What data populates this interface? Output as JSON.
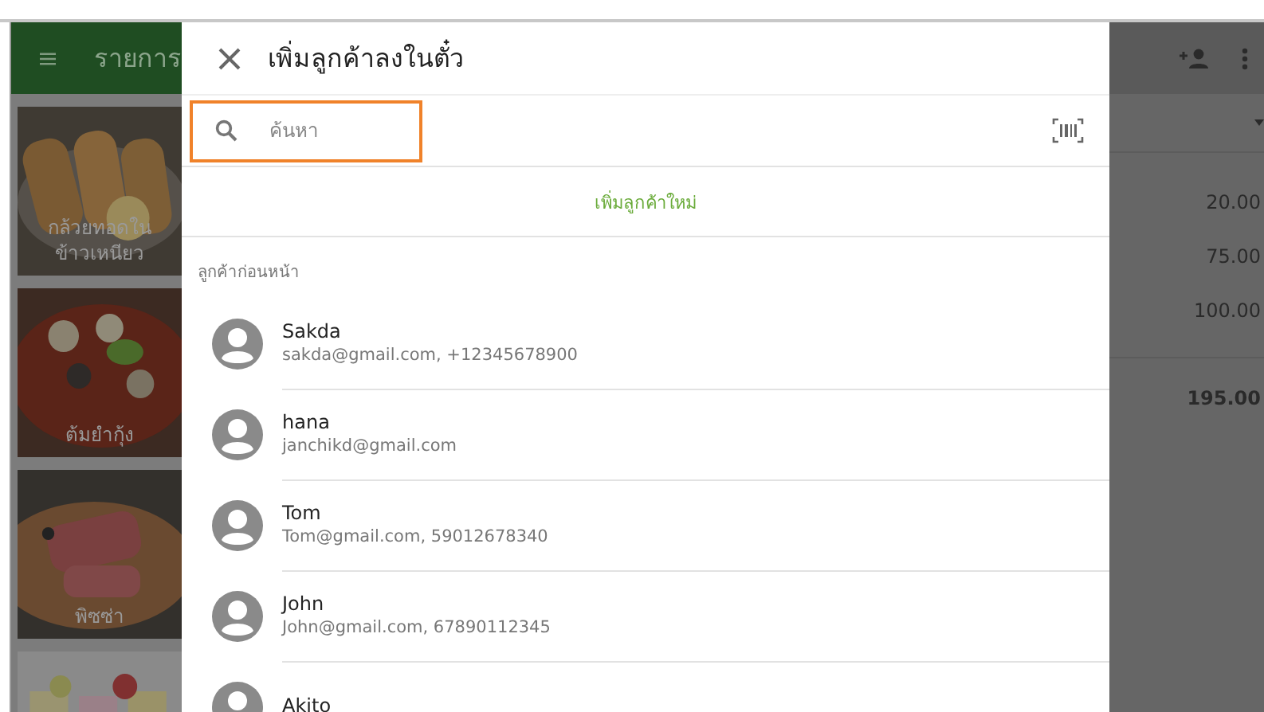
{
  "background_app": {
    "header": {
      "title": "รายการ"
    },
    "tiles": [
      {
        "label": "กล้วยทอดใน ข้าวเหนียว",
        "kind": "picture"
      },
      {
        "label": "ต้มยำกุ้ง",
        "kind": "picture"
      },
      {
        "label": "พิซซ่า",
        "kind": "picture"
      },
      {
        "kind": "picture"
      }
    ],
    "amounts": [
      "20.00",
      "75.00",
      "100.00"
    ],
    "total": "195.00"
  },
  "dialog": {
    "title": "เพิ่มลูกค้าลงในตั๋ว",
    "search": {
      "placeholder": "ค้นหา"
    },
    "add_new": "เพิ่มลูกค้าใหม่",
    "section_label": "ลูกค้าก่อนหน้า",
    "customers": [
      {
        "name": "Sakda",
        "detail": "sakda@gmail.com, +12345678900"
      },
      {
        "name": "hana",
        "detail": "janchikd@gmail.com"
      },
      {
        "name": "Tom",
        "detail": "Tom@gmail.com, 59012678340"
      },
      {
        "name": "John",
        "detail": "John@gmail.com, 67890112345"
      },
      {
        "name": "Akito"
      }
    ]
  }
}
